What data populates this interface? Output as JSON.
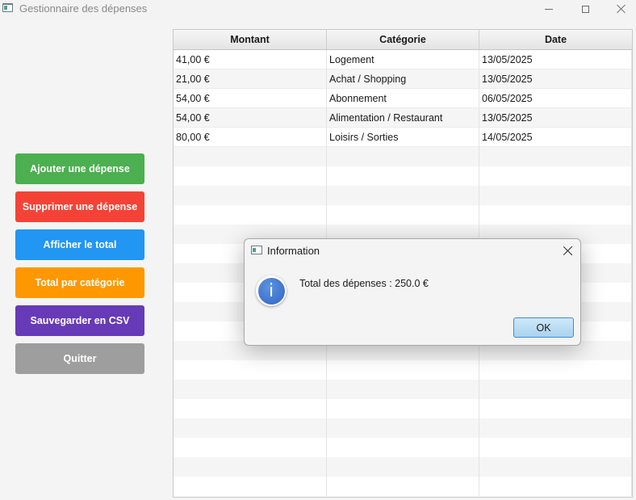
{
  "window": {
    "title": "Gestionnaire des dépenses"
  },
  "actions": [
    {
      "label": "Ajouter une dépense",
      "color": "#4caf50"
    },
    {
      "label": "Supprimer une dépense",
      "color": "#f44336"
    },
    {
      "label": "Afficher le total",
      "color": "#2196f3"
    },
    {
      "label": "Total par catégorie",
      "color": "#ff9800"
    },
    {
      "label": "Sauvegarder en CSV",
      "color": "#673ab7"
    },
    {
      "label": "Quitter",
      "color": "#9e9e9e"
    }
  ],
  "table": {
    "columns": [
      "Montant",
      "Catégorie",
      "Date"
    ],
    "rows": [
      [
        "41,00 €",
        "Logement",
        "13/05/2025"
      ],
      [
        "21,00 €",
        "Achat / Shopping",
        "13/05/2025"
      ],
      [
        "54,00 €",
        "Abonnement",
        "06/05/2025"
      ],
      [
        "54,00 €",
        "Alimentation / Restaurant",
        "13/05/2025"
      ],
      [
        "80,00 €",
        "Loisirs / Sorties",
        "14/05/2025"
      ]
    ]
  },
  "dialog": {
    "title": "Information",
    "message": "Total des dépenses :  250.0 €",
    "ok_label": "OK",
    "icon": "info-icon",
    "icon_glyph": "i"
  }
}
